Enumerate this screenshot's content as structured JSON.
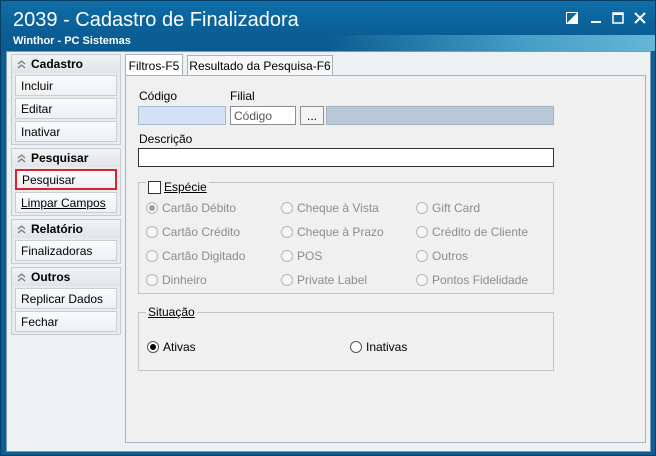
{
  "window": {
    "title": "2039 - Cadastro de Finalizadora",
    "subtitle": "Winthor - PC Sistemas"
  },
  "sidebar": {
    "groups": [
      {
        "title": "Cadastro",
        "items": [
          "Incluir",
          "Editar",
          "Inativar"
        ]
      },
      {
        "title": "Pesquisar",
        "items": [
          "Pesquisar",
          "Limpar Campos"
        ]
      },
      {
        "title": "Relatório",
        "items": [
          "Finalizadoras"
        ]
      },
      {
        "title": "Outros",
        "items": [
          "Replicar Dados",
          "Fechar"
        ]
      }
    ]
  },
  "tabs": [
    "Filtros-F5",
    "Resultado da Pesquisa-F6"
  ],
  "filters": {
    "codigo_label": "Código",
    "filial_label": "Filial",
    "filial_placeholder": "Código",
    "ellipsis": "...",
    "descricao_label": "Descrição",
    "especie_label": "Espécie",
    "especie_options": [
      [
        "Cartão Débito",
        "Cheque à Vista",
        "Gift Card"
      ],
      [
        "Cartão Crédito",
        "Cheque à Prazo",
        "Crédito de Cliente"
      ],
      [
        "Cartão Digitado",
        "POS",
        "Outros"
      ],
      [
        "Dinheiro",
        "Private Label",
        "Pontos Fidelidade"
      ]
    ],
    "situacao_label": "Situação",
    "situacao_options": [
      "Ativas",
      "Inativas"
    ],
    "situacao_selected": "Ativas"
  },
  "colors": {
    "highlight": "#e0212b",
    "titlebar": "#0a5f96"
  }
}
